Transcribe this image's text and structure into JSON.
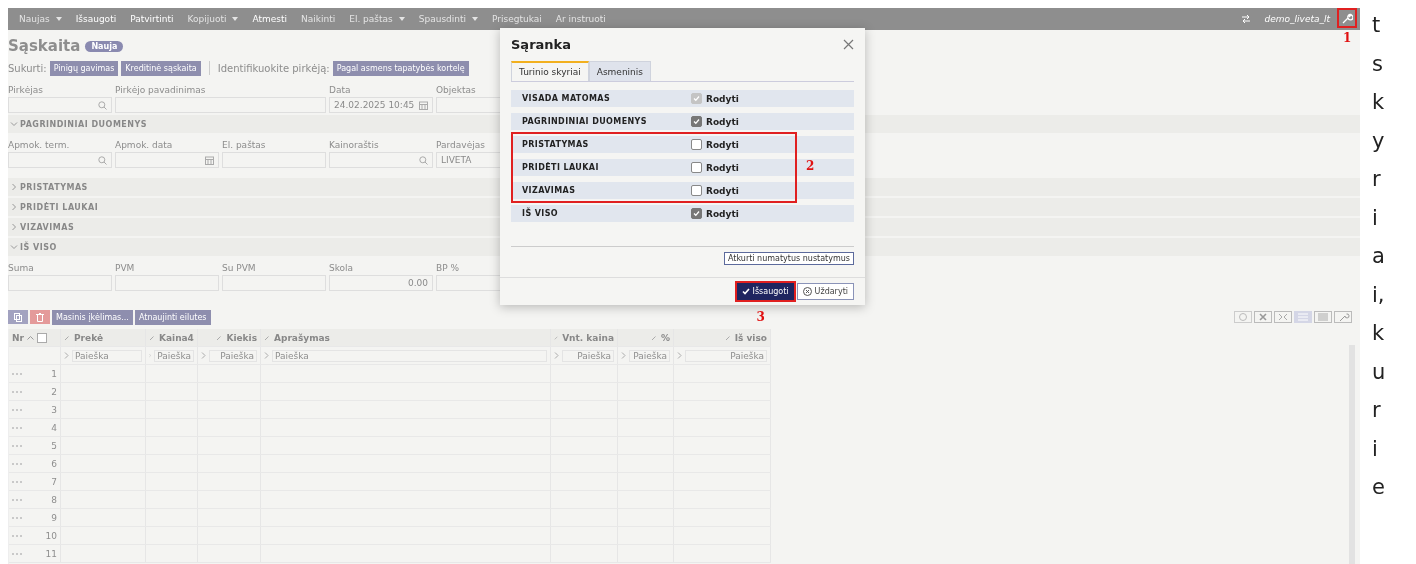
{
  "toolbar": {
    "items": [
      {
        "label": "Naujas",
        "dropdown": true,
        "disabled": true
      },
      {
        "label": "Išsaugoti",
        "dropdown": false,
        "disabled": false
      },
      {
        "label": "Patvirtinti",
        "dropdown": false,
        "disabled": false
      },
      {
        "label": "Kopijuoti",
        "dropdown": true,
        "disabled": true
      },
      {
        "label": "Atmesti",
        "dropdown": false,
        "disabled": false
      },
      {
        "label": "Naikinti",
        "dropdown": false,
        "disabled": true
      },
      {
        "label": "El. paštas",
        "dropdown": true,
        "disabled": true
      },
      {
        "label": "Spausdinti",
        "dropdown": true,
        "disabled": true
      },
      {
        "label": "Prisegtukai",
        "dropdown": false,
        "disabled": true
      },
      {
        "label": "Ar instruoti",
        "dropdown": false,
        "disabled": true
      }
    ],
    "user": "demo_liveta_lt",
    "callout": "1"
  },
  "document": {
    "title": "Sąskaita",
    "badge": "Nauja",
    "create_label": "Sukurti:",
    "create_buttons": [
      "Pinigų gavimas",
      "Kreditinė sąskaita"
    ],
    "identify_label": "Identifikuokite pirkėją:",
    "identify_button": "Pagal asmens tapatybės kortelę"
  },
  "header_fields": [
    {
      "label": "Pirkėjas",
      "kind": "lookup"
    },
    {
      "label": "Pirkėjo pavadinimas",
      "kind": "wide"
    },
    {
      "label": "Data",
      "kind": "date",
      "value": "24.02.2025 10:45"
    },
    {
      "label": "Objektas",
      "kind": "text"
    }
  ],
  "sections": [
    {
      "title": "PAGRINDINIAI DUOMENYS",
      "expanded": true,
      "fields": [
        {
          "label": "Apmok. term.",
          "kind": "lookup"
        },
        {
          "label": "Apmok. data",
          "kind": "date"
        },
        {
          "label": "El. paštas",
          "kind": "text"
        },
        {
          "label": "Kainoraštis",
          "kind": "lookup"
        },
        {
          "label": "Pardavėjas",
          "kind": "text",
          "value": "LIVETA"
        }
      ]
    },
    {
      "title": "PRISTATYMAS",
      "expanded": false
    },
    {
      "title": "PRIDĖTI LAUKAI",
      "expanded": false
    },
    {
      "title": "VIZAVIMAS",
      "expanded": false
    },
    {
      "title": "IŠ VISO",
      "expanded": true,
      "fields": [
        {
          "label": "Suma",
          "kind": "text"
        },
        {
          "label": "PVM",
          "kind": "text"
        },
        {
          "label": "Su PVM",
          "kind": "text"
        },
        {
          "label": "Skola",
          "kind": "number",
          "value": "0.00"
        },
        {
          "label": "BP %",
          "kind": "text"
        }
      ]
    }
  ],
  "rows_toolbar": {
    "buttons": [
      "Masinis įkėlimas...",
      "Atnaujinti eilutes"
    ]
  },
  "table": {
    "select_all_checked": false,
    "columns": [
      {
        "label": "Nr"
      },
      {
        "label": "Prekė",
        "search": "Paieška"
      },
      {
        "label": "Kaina4",
        "search": "Paieška"
      },
      {
        "label": "Kiekis",
        "search": "Paieška"
      },
      {
        "label": "Aprašymas",
        "search": "Paieška"
      },
      {
        "label": "Vnt. kaina",
        "search": "Paieška"
      },
      {
        "label": "%",
        "search": "Paieška"
      },
      {
        "label": "Iš viso",
        "search": "Paieška"
      }
    ],
    "rows": [
      "1",
      "2",
      "3",
      "4",
      "5",
      "6",
      "7",
      "8",
      "9",
      "10",
      "11"
    ]
  },
  "dialog": {
    "title": "Sąranka",
    "tabs": [
      {
        "label": "Turinio skyriai",
        "selected": true
      },
      {
        "label": "Asmeninis",
        "selected": false
      }
    ],
    "rows": [
      {
        "name": "VISADA MATOMAS",
        "checked": true,
        "disabled": true,
        "highlighted": false,
        "label": "Rodyti"
      },
      {
        "name": "PAGRINDINIAI DUOMENYS",
        "checked": true,
        "disabled": false,
        "highlighted": false,
        "label": "Rodyti"
      },
      {
        "name": "PRISTATYMAS",
        "checked": false,
        "disabled": false,
        "highlighted": true,
        "label": "Rodyti"
      },
      {
        "name": "PRIDĖTI LAUKAI",
        "checked": false,
        "disabled": false,
        "highlighted": true,
        "label": "Rodyti"
      },
      {
        "name": "VIZAVIMAS",
        "checked": false,
        "disabled": false,
        "highlighted": true,
        "label": "Rodyti"
      },
      {
        "name": "IŠ VISO",
        "checked": true,
        "disabled": false,
        "highlighted": false,
        "label": "Rodyti"
      }
    ],
    "rows_callout": "2",
    "reset_button": "Atkurti numatytus nustatymus",
    "save_button": "Išsaugoti",
    "save_callout": "3",
    "close_button": "Uždaryti"
  },
  "side_text": "t skyriai, kurie"
}
